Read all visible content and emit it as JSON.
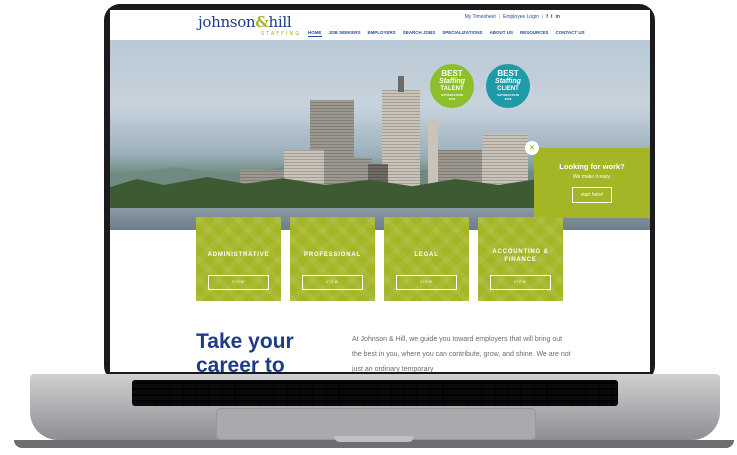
{
  "header": {
    "logo_word_1": "johnson",
    "logo_amp": "&",
    "logo_word_2": "hill",
    "logo_sub": "STAFFING",
    "utility_links": [
      "My Timesheet",
      "Employee Login"
    ],
    "social_icons": [
      "f",
      "t",
      "in"
    ],
    "nav": [
      "HOME",
      "JOB SEEKERS",
      "EMPLOYERS",
      "SEARCH JOBS",
      "SPECIALIZATIONS",
      "ABOUT US",
      "RESOURCES",
      "CONTACT US"
    ]
  },
  "badges": {
    "talent": {
      "best": "BEST",
      "of": "Staffing",
      "label": "TALENT",
      "sub": "SATISFACTION",
      "year": "2019"
    },
    "client": {
      "best": "BEST",
      "of": "Staffing",
      "label": "CLIENT",
      "sub": "SATISFACTION",
      "year": "2019"
    }
  },
  "cta": {
    "title": "Looking for work?",
    "subtitle": "We make it easy.",
    "button": "start here!",
    "close": "×"
  },
  "tiles": [
    {
      "label": "ADMINISTRATIVE",
      "button": "VIEW"
    },
    {
      "label": "PROFESSIONAL",
      "button": "VIEW"
    },
    {
      "label": "LEGAL",
      "button": "VIEW"
    },
    {
      "label": "ACCOUNTING & FINANCE",
      "button": "VIEW"
    }
  ],
  "content": {
    "headline_1": "Take your",
    "headline_2": "career to",
    "intro": "At Johnson & Hill, we guide you toward employers that will bring out the best in you, where you can contribute, grow, and shine. We are not just an ordinary temporary"
  },
  "colors": {
    "brand_blue": "#1e3a8a",
    "brand_green": "#a4b526",
    "badge_teal": "#1f9aa8"
  }
}
